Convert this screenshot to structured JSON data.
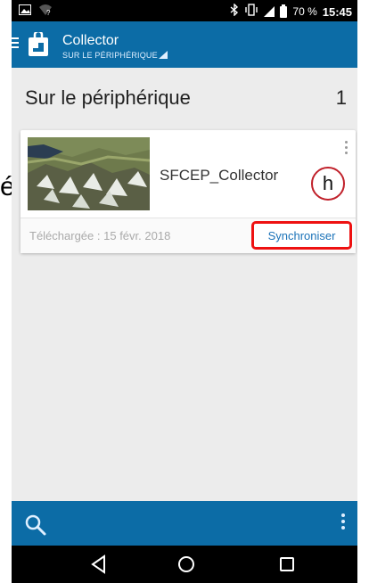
{
  "status_bar": {
    "battery_percent": "70 %",
    "time": "15:45"
  },
  "app_bar": {
    "title": "Collector",
    "subtitle": "SUR LE PÉRIPHÉRIQUE"
  },
  "section": {
    "title": "Sur le périphérique",
    "count": "1"
  },
  "map_card": {
    "name": "SFCEP_Collector",
    "date_label": "Téléchargée :",
    "date_value": "15 févr. 2018",
    "sync_label": "Synchroniser"
  },
  "annotation": {
    "label": "h",
    "edge_char": "é"
  },
  "icons": {
    "status_left": [
      "picture-icon",
      "wifi-question-icon"
    ],
    "status_right": [
      "bluetooth-icon",
      "vibrate-icon",
      "signal-icon",
      "battery-icon"
    ],
    "app_bar": [
      "hamburger-icon",
      "collector-app-icon"
    ],
    "bottom_bar": [
      "search-icon",
      "more-vert-icon"
    ],
    "nav_bar": [
      "back-icon",
      "home-icon",
      "recents-icon"
    ]
  },
  "colors": {
    "app_bar": "#0c6ca6",
    "sync_text": "#1a72b8",
    "highlight_border": "#e11111",
    "annotation_border": "#c0202a"
  }
}
